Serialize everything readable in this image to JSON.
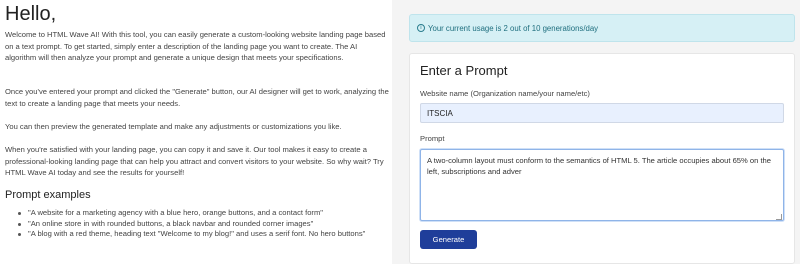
{
  "left": {
    "greeting": "Hello,",
    "paragraphs": [
      "Welcome to HTML Wave AI! With this tool, you can easily generate a custom-looking website landing page based on a text prompt. To get started, simply enter a description of the landing page you want to create. The AI algorithm will then analyze your prompt and generate a unique design that meets your specifications.",
      "Once you've entered your prompt and clicked the \"Generate\" button, our AI designer will get to work, analyzing the text to create a landing page that meets your needs.",
      "You can then preview the generated template and make any adjustments or customizations you like.",
      "When you're satisfied with your landing page, you can copy it and save it. Our tool makes it easy to create a professional-looking landing page that can help you attract and convert visitors to your website. So why wait? Try HTML Wave AI today and see the results for yourself!"
    ],
    "examples_title": "Prompt examples",
    "examples": [
      "\"A website for a marketing agency with a blue hero, orange buttons, and a contact form\"",
      "\"An online store in with rounded buttons, a black navbar and rounded corner images\"",
      "\"A blog with a red theme, heading text \"Welcome to my blog!\" and uses a serif font. No hero buttons\""
    ]
  },
  "alert": {
    "icon": "info-icon",
    "text": "Your current usage is 2 out of 10 generations/day"
  },
  "form": {
    "title": "Enter a Prompt",
    "website_label": "Website name (Organization name/your name/etc)",
    "website_value": "ITSCIA",
    "prompt_label": "Prompt",
    "prompt_value": "A two-column layout must conform to the semantics of HTML 5. The article occupies about 65% on the left, subscriptions and adver",
    "generate_label": "Generate"
  },
  "colors": {
    "primary_button": "#1f3e9a",
    "alert_bg": "#d6f0f5",
    "input_bg": "#e8f0fe"
  }
}
